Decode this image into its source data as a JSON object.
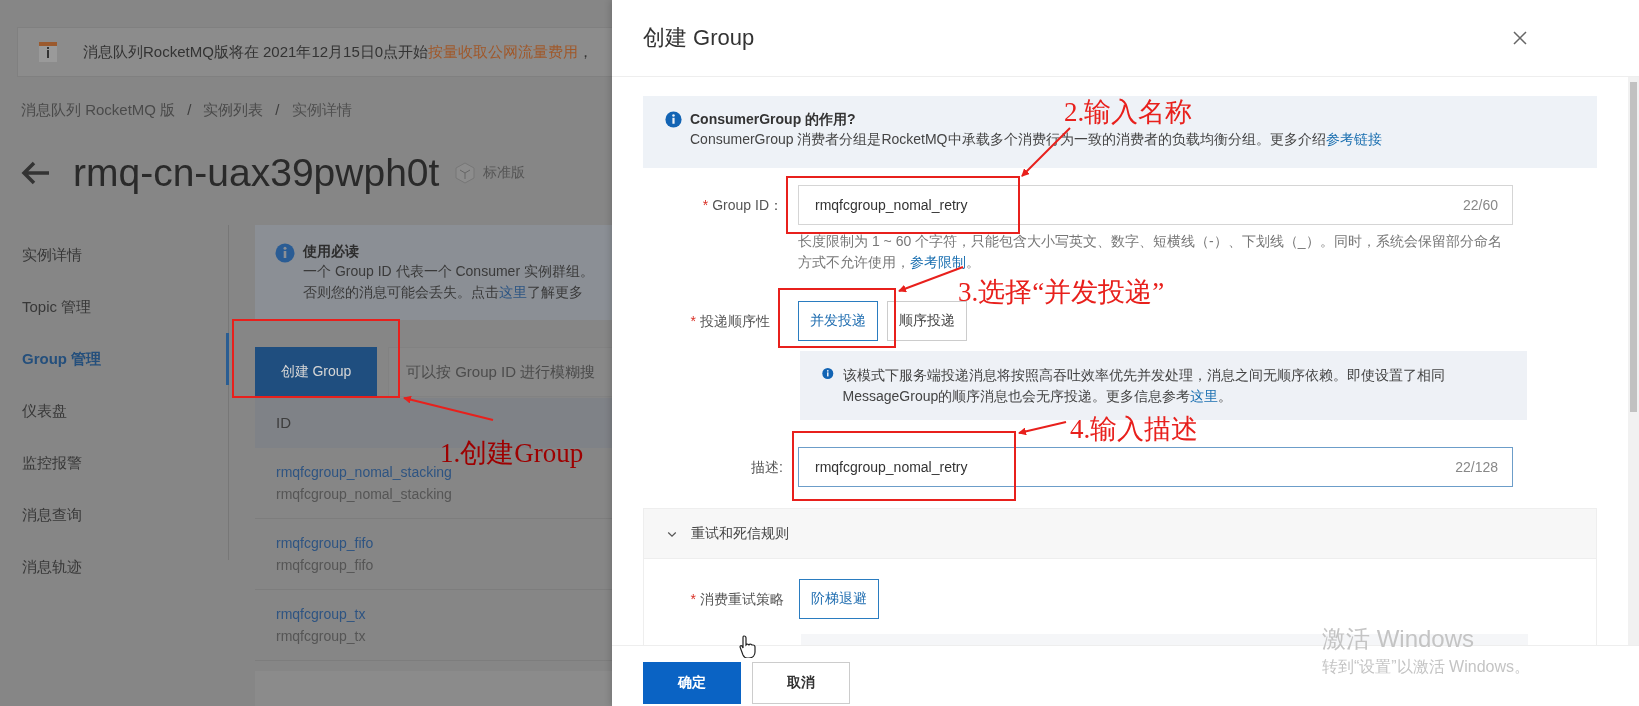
{
  "notice": {
    "text": "消息队列RocketMQ版将在 2021年12月15日0点开始",
    "link": "按量收取公网流量费用",
    "tail": "，"
  },
  "breadcrumb": {
    "items": [
      "消息队列 RocketMQ 版",
      "实例列表",
      "实例详情"
    ],
    "separators": [
      "/",
      "/"
    ]
  },
  "instance": {
    "title": "rmq-cn-uax39pwph0t",
    "edition": "标准版"
  },
  "sidebar": {
    "items": [
      {
        "label": "实例详情",
        "selected": false
      },
      {
        "label": "Topic 管理",
        "selected": false
      },
      {
        "label": "Group 管理",
        "selected": true
      },
      {
        "label": "仪表盘",
        "selected": false
      },
      {
        "label": "监控报警",
        "selected": false
      },
      {
        "label": "消息查询",
        "selected": false
      },
      {
        "label": "消息轨迹",
        "selected": false
      }
    ]
  },
  "guide": {
    "title": "使用必读",
    "line_1": "一个 Group ID 代表一个 Consumer 实例群组。",
    "line_2": "否则您的消息可能会丢失。点击",
    "link": "这里",
    "line_2_end": "了解更多"
  },
  "create_button": "创建 Group",
  "search": {
    "placeholder": "可以按 Group ID 进行模糊搜"
  },
  "table": {
    "columns": [
      "ID"
    ],
    "rows": [
      {
        "id": "rmqfcgroup_nomal_stacking",
        "description": "rmqfcgroup_nomal_stacking"
      },
      {
        "id": "rmqfcgroup_fifo",
        "description": "rmqfcgroup_fifo"
      },
      {
        "id": "rmqfcgroup_tx",
        "description": "rmqfcgroup_tx"
      }
    ]
  },
  "drawer": {
    "title": "创建 Group",
    "info": {
      "title": "ConsumerGroup 的作用?",
      "text": "ConsumerGroup 消费者分组是RocketMQ中承载多个消费行为一致的消费者的负载均衡分组。更多介绍",
      "link": "参考链接"
    },
    "group_id": {
      "mark": "*",
      "label": "Group ID：",
      "value": "rmqfcgroup_nomal_retry",
      "count": "22/60",
      "hint": "长度限制为 1 ~ 60 个字符，只能包含大小写英文、数字、短横线（-）、下划线（_）。同时，系统会保留部分命名方式不允许使用，",
      "hint_link": "参考限制",
      "hint_end": "。"
    },
    "delivery": {
      "mark": "*",
      "label": "投递顺序性",
      "options": [
        {
          "label": "并发投递",
          "selected": true
        },
        {
          "label": "顺序投递",
          "selected": false
        }
      ],
      "note": "该模式下服务端投递消息将按照高吞吐效率优先并发处理，消息之间无顺序依赖。即使设置了相同MessageGroup的顺序消息也会无序投递。更多信息参考",
      "note_link": "这里",
      "note_end": "。"
    },
    "description": {
      "label": "描述:",
      "value": "rmqfcgroup_nomal_retry",
      "count": "22/128"
    },
    "retry": {
      "title": "重试和死信规则",
      "expanded": true,
      "policy": {
        "mark": "*",
        "label": "消费重试策略",
        "options": [
          {
            "label": "阶梯退避",
            "selected": true
          }
        ]
      }
    },
    "buttons": [
      {
        "label": "确定",
        "kind": "primary"
      },
      {
        "label": "取消",
        "kind": "default"
      }
    ]
  },
  "annotations": [
    {
      "text": "1.创建Group"
    },
    {
      "text": "2.输入名称"
    },
    {
      "text": "3.选择“并发投递”"
    },
    {
      "text": "4.输入描述"
    }
  ],
  "os_notice": {
    "title": "激活 Windows",
    "text": "转到“设置”以激活 Windows。"
  }
}
